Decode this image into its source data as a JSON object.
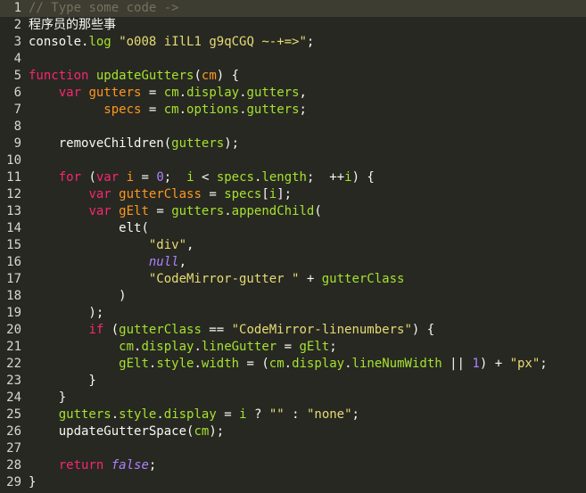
{
  "editor": {
    "placeholder": "Type some code ->",
    "active_line": 1,
    "lines": [
      {
        "n": "1",
        "tokens": [
          [
            "comment",
            "// "
          ],
          [
            "placeholder",
            "Type some code ->"
          ]
        ]
      },
      {
        "n": "2",
        "tokens": [
          [
            "cjk",
            "程序员的那些事"
          ]
        ]
      },
      {
        "n": "3",
        "tokens": [
          [
            "var",
            "console"
          ],
          [
            "op",
            "."
          ],
          [
            "prop",
            "log"
          ],
          [
            "op",
            " "
          ],
          [
            "str",
            "\"o008 iIlL1 g9qCGQ ~-+=>\""
          ],
          [
            "op",
            ";"
          ]
        ]
      },
      {
        "n": "4",
        "tokens": []
      },
      {
        "n": "5",
        "tokens": [
          [
            "kw",
            "function"
          ],
          [
            "op",
            " "
          ],
          [
            "fn",
            "updateGutters"
          ],
          [
            "op",
            "("
          ],
          [
            "def",
            "cm"
          ],
          [
            "op",
            ") {"
          ]
        ]
      },
      {
        "n": "6",
        "tokens": [
          [
            "op",
            "    "
          ],
          [
            "kw",
            "var"
          ],
          [
            "op",
            " "
          ],
          [
            "def",
            "gutters"
          ],
          [
            "op",
            " = "
          ],
          [
            "var2",
            "cm"
          ],
          [
            "op",
            "."
          ],
          [
            "prop",
            "display"
          ],
          [
            "op",
            "."
          ],
          [
            "prop",
            "gutters"
          ],
          [
            "op",
            ","
          ]
        ]
      },
      {
        "n": "7",
        "tokens": [
          [
            "op",
            "          "
          ],
          [
            "def",
            "specs"
          ],
          [
            "op",
            " = "
          ],
          [
            "var2",
            "cm"
          ],
          [
            "op",
            "."
          ],
          [
            "prop",
            "options"
          ],
          [
            "op",
            "."
          ],
          [
            "prop",
            "gutters"
          ],
          [
            "op",
            ";"
          ]
        ]
      },
      {
        "n": "8",
        "tokens": []
      },
      {
        "n": "9",
        "tokens": [
          [
            "op",
            "    "
          ],
          [
            "var",
            "removeChildren"
          ],
          [
            "op",
            "("
          ],
          [
            "var2",
            "gutters"
          ],
          [
            "op",
            ");"
          ]
        ]
      },
      {
        "n": "10",
        "tokens": []
      },
      {
        "n": "11",
        "tokens": [
          [
            "op",
            "    "
          ],
          [
            "kw",
            "for"
          ],
          [
            "op",
            " ("
          ],
          [
            "kw",
            "var"
          ],
          [
            "op",
            " "
          ],
          [
            "def",
            "i"
          ],
          [
            "op",
            " = "
          ],
          [
            "num",
            "0"
          ],
          [
            "op",
            ";  "
          ],
          [
            "var2",
            "i"
          ],
          [
            "op",
            " < "
          ],
          [
            "var2",
            "specs"
          ],
          [
            "op",
            "."
          ],
          [
            "prop",
            "length"
          ],
          [
            "op",
            ";  ++"
          ],
          [
            "var2",
            "i"
          ],
          [
            "op",
            ") {"
          ]
        ]
      },
      {
        "n": "12",
        "tokens": [
          [
            "op",
            "        "
          ],
          [
            "kw",
            "var"
          ],
          [
            "op",
            " "
          ],
          [
            "def",
            "gutterClass"
          ],
          [
            "op",
            " = "
          ],
          [
            "var2",
            "specs"
          ],
          [
            "op",
            "["
          ],
          [
            "var2",
            "i"
          ],
          [
            "op",
            "];"
          ]
        ]
      },
      {
        "n": "13",
        "tokens": [
          [
            "op",
            "        "
          ],
          [
            "kw",
            "var"
          ],
          [
            "op",
            " "
          ],
          [
            "def",
            "gElt"
          ],
          [
            "op",
            " = "
          ],
          [
            "var2",
            "gutters"
          ],
          [
            "op",
            "."
          ],
          [
            "prop",
            "appendChild"
          ],
          [
            "op",
            "("
          ]
        ]
      },
      {
        "n": "14",
        "tokens": [
          [
            "op",
            "            "
          ],
          [
            "var",
            "elt"
          ],
          [
            "op",
            "("
          ]
        ]
      },
      {
        "n": "15",
        "tokens": [
          [
            "op",
            "                "
          ],
          [
            "str",
            "\"div\""
          ],
          [
            "op",
            ","
          ]
        ]
      },
      {
        "n": "16",
        "tokens": [
          [
            "op",
            "                "
          ],
          [
            "atom",
            "null"
          ],
          [
            "op",
            ","
          ]
        ]
      },
      {
        "n": "17",
        "tokens": [
          [
            "op",
            "                "
          ],
          [
            "str",
            "\"CodeMirror-gutter \""
          ],
          [
            "op",
            " + "
          ],
          [
            "var2",
            "gutterClass"
          ]
        ]
      },
      {
        "n": "18",
        "tokens": [
          [
            "op",
            "            )"
          ]
        ]
      },
      {
        "n": "19",
        "tokens": [
          [
            "op",
            "        );"
          ]
        ]
      },
      {
        "n": "20",
        "tokens": [
          [
            "op",
            "        "
          ],
          [
            "kw",
            "if"
          ],
          [
            "op",
            " ("
          ],
          [
            "var2",
            "gutterClass"
          ],
          [
            "op",
            " == "
          ],
          [
            "str",
            "\"CodeMirror-linenumbers\""
          ],
          [
            "op",
            ") {"
          ]
        ]
      },
      {
        "n": "21",
        "tokens": [
          [
            "op",
            "            "
          ],
          [
            "var2",
            "cm"
          ],
          [
            "op",
            "."
          ],
          [
            "prop",
            "display"
          ],
          [
            "op",
            "."
          ],
          [
            "prop",
            "lineGutter"
          ],
          [
            "op",
            " = "
          ],
          [
            "var2",
            "gElt"
          ],
          [
            "op",
            ";"
          ]
        ]
      },
      {
        "n": "22",
        "tokens": [
          [
            "op",
            "            "
          ],
          [
            "var2",
            "gElt"
          ],
          [
            "op",
            "."
          ],
          [
            "prop",
            "style"
          ],
          [
            "op",
            "."
          ],
          [
            "prop",
            "width"
          ],
          [
            "op",
            " = ("
          ],
          [
            "var2",
            "cm"
          ],
          [
            "op",
            "."
          ],
          [
            "prop",
            "display"
          ],
          [
            "op",
            "."
          ],
          [
            "prop",
            "lineNumWidth"
          ],
          [
            "op",
            " || "
          ],
          [
            "num",
            "1"
          ],
          [
            "op",
            ") + "
          ],
          [
            "str",
            "\"px\""
          ],
          [
            "op",
            ";"
          ]
        ]
      },
      {
        "n": "23",
        "tokens": [
          [
            "op",
            "        }"
          ]
        ]
      },
      {
        "n": "24",
        "tokens": [
          [
            "op",
            "    }"
          ]
        ]
      },
      {
        "n": "25",
        "tokens": [
          [
            "op",
            "    "
          ],
          [
            "var2",
            "gutters"
          ],
          [
            "op",
            "."
          ],
          [
            "prop",
            "style"
          ],
          [
            "op",
            "."
          ],
          [
            "prop",
            "display"
          ],
          [
            "op",
            " = "
          ],
          [
            "var2",
            "i"
          ],
          [
            "op",
            " ? "
          ],
          [
            "str",
            "\"\""
          ],
          [
            "op",
            " : "
          ],
          [
            "str",
            "\"none\""
          ],
          [
            "op",
            ";"
          ]
        ]
      },
      {
        "n": "26",
        "tokens": [
          [
            "op",
            "    "
          ],
          [
            "var",
            "updateGutterSpace"
          ],
          [
            "op",
            "("
          ],
          [
            "var2",
            "cm"
          ],
          [
            "op",
            ");"
          ]
        ]
      },
      {
        "n": "27",
        "tokens": []
      },
      {
        "n": "28",
        "tokens": [
          [
            "op",
            "    "
          ],
          [
            "kw",
            "return"
          ],
          [
            "op",
            " "
          ],
          [
            "atom",
            "false"
          ],
          [
            "op",
            ";"
          ]
        ]
      },
      {
        "n": "29",
        "tokens": [
          [
            "op",
            "}"
          ]
        ]
      }
    ]
  }
}
